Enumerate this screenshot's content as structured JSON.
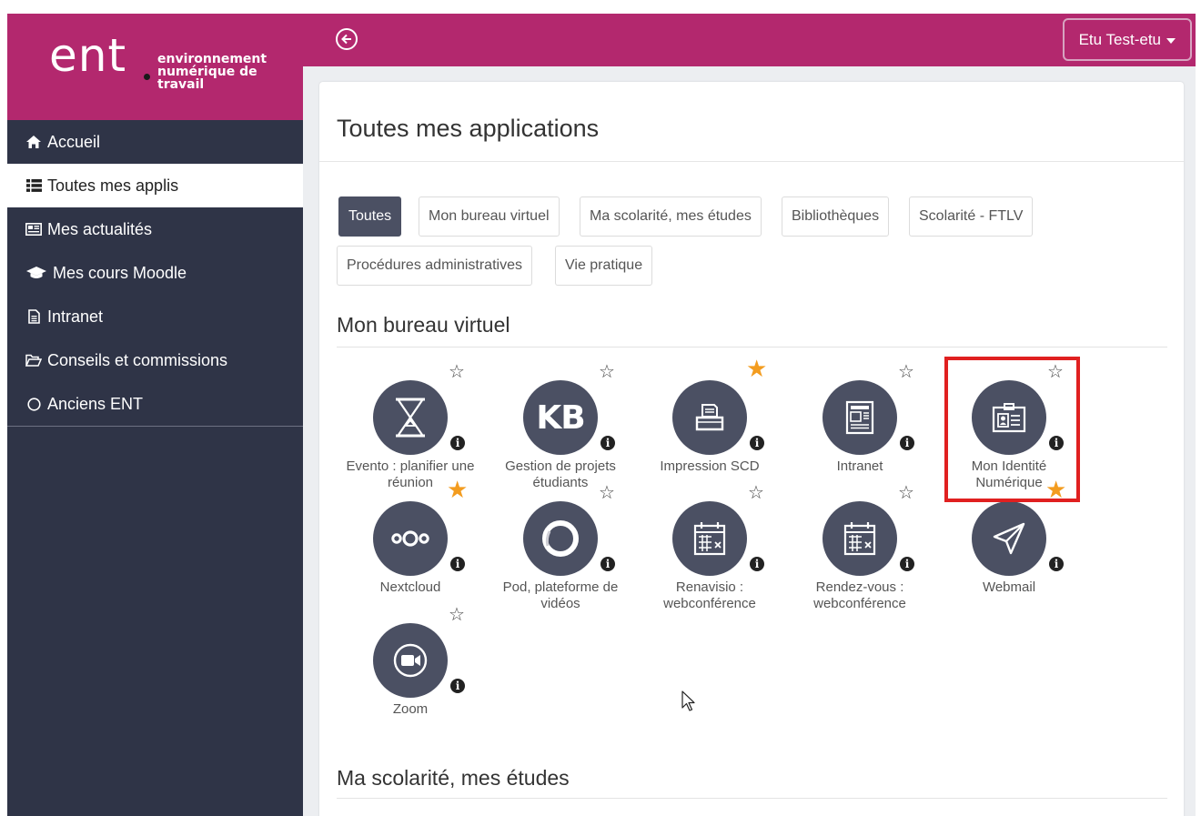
{
  "brand": {
    "logo_text": "ent",
    "subtitle_line1": "environnement",
    "subtitle_line2": "numérique de",
    "subtitle_line3": "travail",
    "color": "#b3286e"
  },
  "sidebar": {
    "items": [
      {
        "label": "Accueil",
        "icon": "home-icon",
        "active": false
      },
      {
        "label": "Toutes mes applis",
        "icon": "list-icon",
        "active": true
      },
      {
        "label": "Mes actualités",
        "icon": "newspaper-icon",
        "active": false
      },
      {
        "label": "Mes cours Moodle",
        "icon": "graduation-cap-icon",
        "active": false
      },
      {
        "label": "Intranet",
        "icon": "document-icon",
        "active": false
      },
      {
        "label": "Conseils et commissions",
        "icon": "folder-open-icon",
        "active": false
      },
      {
        "label": "Anciens ENT",
        "icon": "circle-icon",
        "active": false
      }
    ]
  },
  "topbar": {
    "user_label": "Etu Test-etu",
    "back_icon": "arrow-left-circle-icon"
  },
  "main": {
    "title": "Toutes mes applications",
    "filters": [
      {
        "label": "Toutes",
        "active": true
      },
      {
        "label": "Mon bureau virtuel",
        "active": false
      },
      {
        "label": "Ma scolarité, mes études",
        "active": false
      },
      {
        "label": "Bibliothèques",
        "active": false
      },
      {
        "label": "Scolarité - FTLV",
        "active": false
      },
      {
        "label": "Procédures administratives",
        "active": false
      },
      {
        "label": "Vie pratique",
        "active": false
      }
    ],
    "section1_title": "Mon bureau virtuel",
    "section2_title": "Ma scolarité, mes études",
    "apps": [
      {
        "name_line1": "Evento : planifier une",
        "name_line2": "réunion",
        "icon": "hourglass-icon",
        "favorite": false
      },
      {
        "name_line1": "Gestion de projets",
        "name_line2": "étudiants",
        "icon": "kb-logo-icon",
        "icon_text": "KB",
        "favorite": false
      },
      {
        "name_line1": "Impression SCD",
        "name_line2": "",
        "icon": "printer-icon",
        "favorite": true
      },
      {
        "name_line1": "Intranet",
        "name_line2": "",
        "icon": "newspaper-icon",
        "favorite": false
      },
      {
        "name_line1": "Mon Identité",
        "name_line2": "Numérique",
        "icon": "id-badge-icon",
        "favorite": false
      },
      {
        "name_line1": "Nextcloud",
        "name_line2": "",
        "icon": "nextcloud-icon",
        "favorite": true
      },
      {
        "name_line1": "Pod, plateforme de",
        "name_line2": "vidéos",
        "icon": "ring-icon",
        "favorite": false
      },
      {
        "name_line1": "Renavisio :",
        "name_line2": "webconférence",
        "icon": "calendar-x-icon",
        "favorite": false
      },
      {
        "name_line1": "Rendez-vous :",
        "name_line2": "webconférence",
        "icon": "calendar-x-icon",
        "favorite": false
      },
      {
        "name_line1": "Webmail",
        "name_line2": "",
        "icon": "paper-plane-icon",
        "favorite": true
      },
      {
        "name_line1": "Zoom",
        "name_line2": "",
        "icon": "video-camera-icon",
        "favorite": false
      }
    ],
    "info_glyph": "i",
    "star_glyph": "☆",
    "star_filled_glyph": "★"
  },
  "colors": {
    "accent": "#b3286e",
    "sidebar_bg": "#2f3447",
    "icon_circle": "#4b5063",
    "favorite": "#f39c1f",
    "highlight": "#e02020"
  }
}
